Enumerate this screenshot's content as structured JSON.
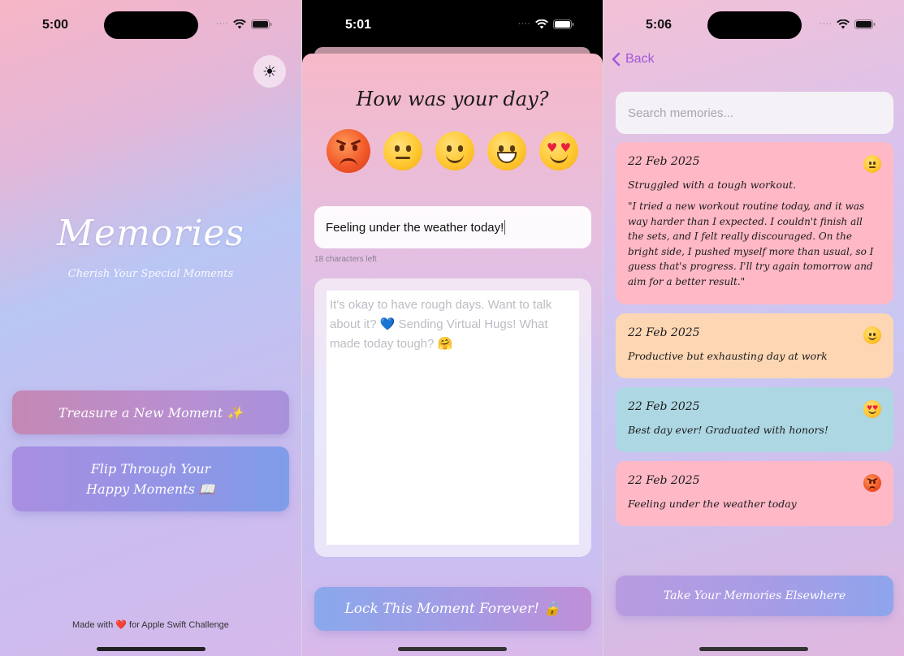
{
  "screens": {
    "home": {
      "status_time": "5:00",
      "title": "Memories",
      "subtitle": "Cherish Your Special Moments",
      "theme_icon": "sun-icon",
      "treasure_button": "Treasure a New Moment ✨",
      "flip_button_line1": "Flip Through Your",
      "flip_button_line2": "Happy Moments 📖",
      "footer_prefix": "Made with",
      "footer_heart": "❤️",
      "footer_suffix": "for Apple Swift Challenge"
    },
    "compose": {
      "status_time": "5:01",
      "question": "How was your day?",
      "moods": [
        "angry",
        "neutral",
        "smiling",
        "grinning",
        "heart-eyes"
      ],
      "selected_mood": "angry",
      "mood_text": "Feeling under the weather today!",
      "chars_left": "18 characters left",
      "entry_placeholder": "It's okay to have rough days. Want to talk about it? 💙 Sending Virtual Hugs! What made today tough? 🤗",
      "lock_button": "Lock This Moment Forever! 🔒"
    },
    "memories": {
      "status_time": "5:06",
      "back_label": "Back",
      "search_placeholder": "Search memories...",
      "entries": [
        {
          "date": "22 Feb 2025",
          "mood": "neutral",
          "title": "Struggled with a tough workout.",
          "body": "\"I tried a new workout routine today, and it was way harder than I expected. I couldn't finish all the sets, and I felt really discouraged. On the bright side, I pushed myself more than usual, so I guess that's progress. I'll try again tomorrow and aim for a better result.\"",
          "color": "#ffb8c6"
        },
        {
          "date": "22 Feb 2025",
          "mood": "smiling",
          "title": "Productive but exhausting day at work",
          "color": "#fdd6b4"
        },
        {
          "date": "22 Feb 2025",
          "mood": "heart-eyes",
          "title": "Best day ever! Graduated with honors!",
          "color": "#add7e3"
        },
        {
          "date": "22 Feb 2025",
          "mood": "angry",
          "title": "Feeling under the weather today",
          "color": "#ffb8c6"
        }
      ],
      "export_button": "Take Your Memories Elsewhere"
    }
  },
  "colors": {
    "accent": "#a058d8",
    "white": "#ffffff"
  }
}
